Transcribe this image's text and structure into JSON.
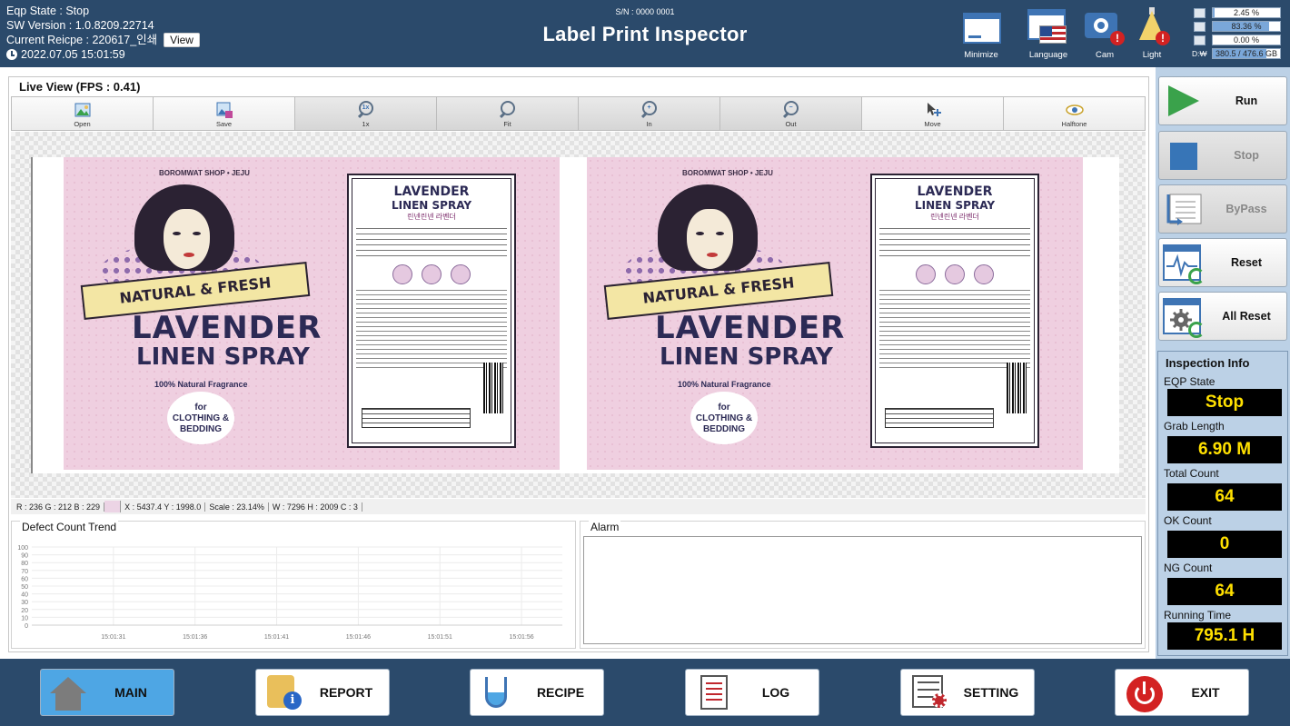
{
  "header": {
    "eqp_state": "Eqp State : Stop",
    "sw_version": "SW Version : 1.0.8209.22714",
    "current_recipe": "Current Reicpe : 220617_인쇄",
    "view_label": "View",
    "datetime": "2022.07.05 15:01:59",
    "serial": "S/N : 0000 0001",
    "title": "Label Print Inspector",
    "buttons": {
      "minimize": "Minimize",
      "language": "Language",
      "cam": "Cam",
      "light": "Light"
    },
    "gauges": [
      {
        "value": "2.45 %",
        "fraction": 0.0245
      },
      {
        "value": "83.36 %",
        "fraction": 0.8336
      },
      {
        "value": "0.00 %",
        "fraction": 0.0
      },
      {
        "label": "D:₩",
        "value": "380.5 / 476.6 GB",
        "fraction": 0.798
      }
    ]
  },
  "live_view": {
    "title": "Live View (FPS : 0.41)",
    "toolbar": [
      {
        "label": "Open",
        "icon": "open-image-icon"
      },
      {
        "label": "Save",
        "icon": "save-image-icon"
      },
      {
        "label": "1x",
        "icon": "zoom-1x-icon"
      },
      {
        "label": "Fit",
        "icon": "zoom-fit-icon"
      },
      {
        "label": "In",
        "icon": "zoom-in-icon"
      },
      {
        "label": "Out",
        "icon": "zoom-out-icon"
      },
      {
        "label": "Move",
        "icon": "move-icon"
      },
      {
        "label": "Halftone",
        "icon": "eye-icon"
      }
    ],
    "label_art": {
      "shop": "BOROMWAT SHOP • JEJU",
      "ribbon": "NATURAL & FRESH",
      "line1": "LAVENDER",
      "line2": "LINEN SPRAY",
      "tagline": "100% Natural Fragrance",
      "burst": "for CLOTHING & BEDDING",
      "back_title1": "LAVENDER",
      "back_title2": "LINEN SPRAY",
      "back_korean": "린넨린넨 라벤더"
    }
  },
  "status_bar": {
    "rgb": "R : 236 G : 212 B : 229",
    "swatch_color": "#ecd4e5",
    "coords": "X : 5437.4 Y : 1998.0",
    "scale": "Scale : 23.14%",
    "size": "W : 7296 H : 2009 C : 3"
  },
  "trend": {
    "title": "Defect Count Trend",
    "y_ticks": [
      "100",
      "90",
      "80",
      "70",
      "60",
      "50",
      "40",
      "30",
      "20",
      "10",
      "0"
    ],
    "x_ticks": [
      "15:01:31",
      "15:01:36",
      "15:01:41",
      "15:01:46",
      "15:01:51",
      "15:01:56"
    ]
  },
  "chart_data": {
    "type": "line",
    "title": "Defect Count Trend",
    "xlabel": "",
    "ylabel": "",
    "categories": [
      "15:01:31",
      "15:01:36",
      "15:01:41",
      "15:01:46",
      "15:01:51",
      "15:01:56"
    ],
    "series": [],
    "ylim": [
      0,
      100
    ],
    "grid": true
  },
  "alarm": {
    "title": "Alarm"
  },
  "sidebar": {
    "run": "Run",
    "stop": "Stop",
    "bypass": "ByPass",
    "reset": "Reset",
    "all_reset": "All Reset"
  },
  "inspection": {
    "title": "Inspection Info",
    "items": [
      {
        "label": "EQP State",
        "value": "Stop"
      },
      {
        "label": "Grab Length",
        "value": "6.90 M"
      },
      {
        "label": "Total Count",
        "value": "64"
      },
      {
        "label": "OK Count",
        "value": "0"
      },
      {
        "label": "NG Count",
        "value": "64"
      },
      {
        "label": "Running Time",
        "value": "795.1 H"
      }
    ]
  },
  "footer": {
    "main": "MAIN",
    "report": "REPORT",
    "recipe": "RECIPE",
    "log": "LOG",
    "setting": "SETTING",
    "exit": "EXIT"
  }
}
